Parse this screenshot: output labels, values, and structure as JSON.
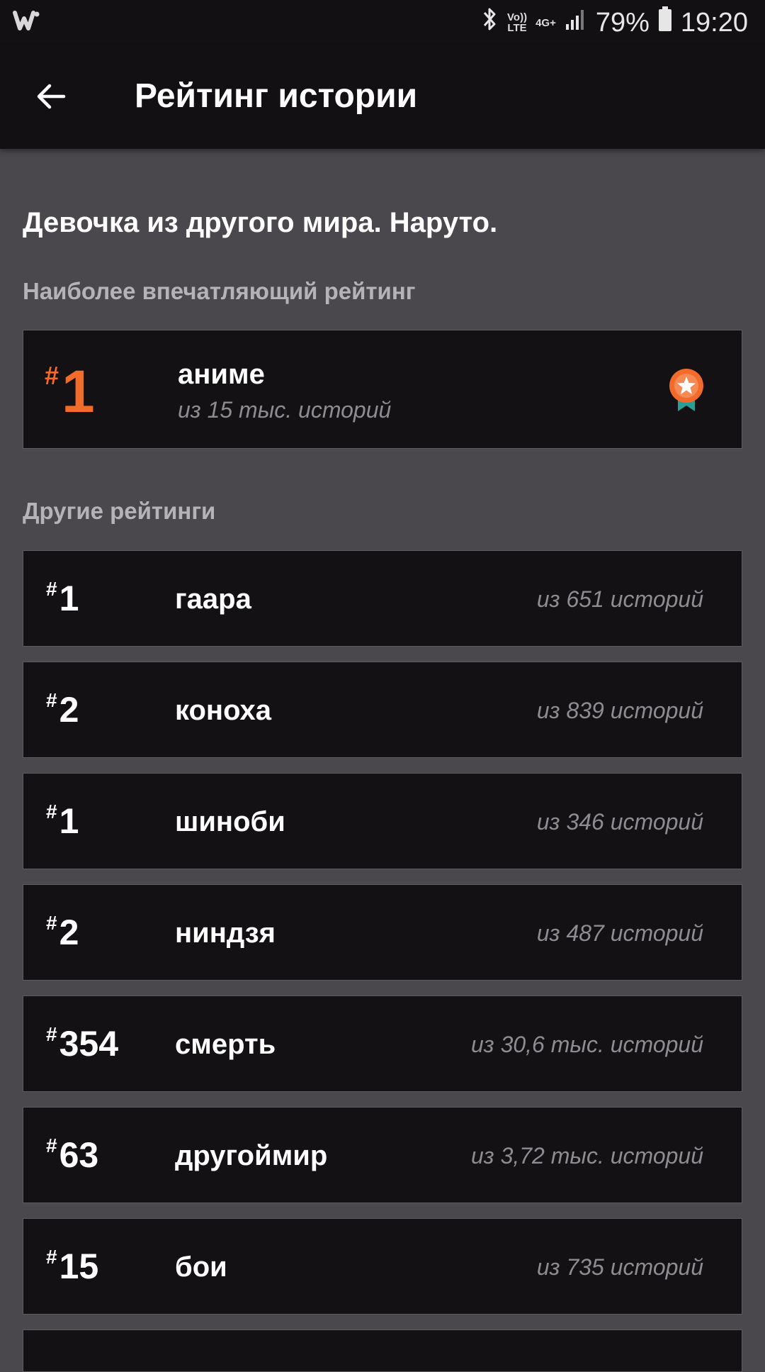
{
  "status_bar": {
    "network_top": "Vo))",
    "network_bottom": "LTE",
    "network_gen": "4G+",
    "battery": "79%",
    "time": "19:20",
    "icons": [
      "wattpad-logo-icon",
      "bluetooth-icon",
      "signal-icon",
      "battery-icon"
    ]
  },
  "header": {
    "title": "Рейтинг истории",
    "back_icon": "arrow-left-icon"
  },
  "story_title": "Девочка из другого мира. Наруто.",
  "featured": {
    "label": "Наиболее впечатляющий рейтинг",
    "hash": "#",
    "rank": "1",
    "tag": "аниме",
    "subtitle": "из 15 тыс. историй",
    "icon": "medal-icon",
    "accent_color": "#f26b2a"
  },
  "others": {
    "label": "Другие рейтинги",
    "hash": "#",
    "items": [
      {
        "rank": "1",
        "tag": "гаара",
        "count": "из 651 историй"
      },
      {
        "rank": "2",
        "tag": "коноха",
        "count": "из 839 историй"
      },
      {
        "rank": "1",
        "tag": "шиноби",
        "count": "из 346 историй"
      },
      {
        "rank": "2",
        "tag": "ниндзя",
        "count": "из 487 историй"
      },
      {
        "rank": "354",
        "tag": "смерть",
        "count": "из 30,6 тыс. историй"
      },
      {
        "rank": "63",
        "tag": "другоймир",
        "count": "из 3,72 тыс. историй"
      },
      {
        "rank": "15",
        "tag": "бои",
        "count": "из 735 историй"
      }
    ]
  }
}
